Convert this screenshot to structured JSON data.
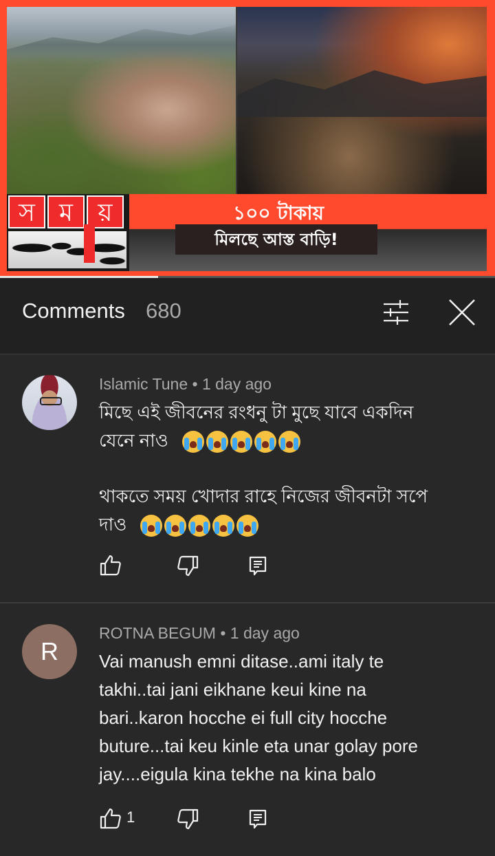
{
  "video": {
    "channel_logo_letters": [
      "স",
      "ম",
      "য়"
    ],
    "headline_top": "১০০ টাকায়",
    "headline_bottom": "মিলছে আস্ত বাড়ি!",
    "progress": 0.32
  },
  "comments_panel": {
    "title": "Comments",
    "count": "680",
    "sort_icon": "sort-filter-icon",
    "close_icon": "close-icon"
  },
  "comments": [
    {
      "author_meta": "Islamic Tune • 1 day ago",
      "avatar": "photo",
      "paragraph1": "মিছে এই জীবনের রংধনু টা মুছে যাবে একদিন\nযেনে নাও",
      "paragraph2": "থাকতে সময় খোদার রাহে নিজের জীবনটা সপে\nদাও",
      "emoji": "loudly-crying-face",
      "likes": ""
    },
    {
      "author_meta": "ROTNA BEGUM • 1 day ago",
      "avatar_letter": "R",
      "paragraph1": "Vai manush emni ditase..ami italy te\ntakhi..tai jani eikhane keui kine na\nbari..karon hocche ei full city hocche\nbuture...tai keu kinle eta unar golay pore\njay....eigula kina tekhe na kina balo",
      "likes": "1"
    }
  ],
  "colors": {
    "background": "#282828",
    "header": "#212121",
    "banner_red": "#ff4a2e",
    "text_primary": "#f1f1f1",
    "text_secondary": "#aaaaaa"
  }
}
